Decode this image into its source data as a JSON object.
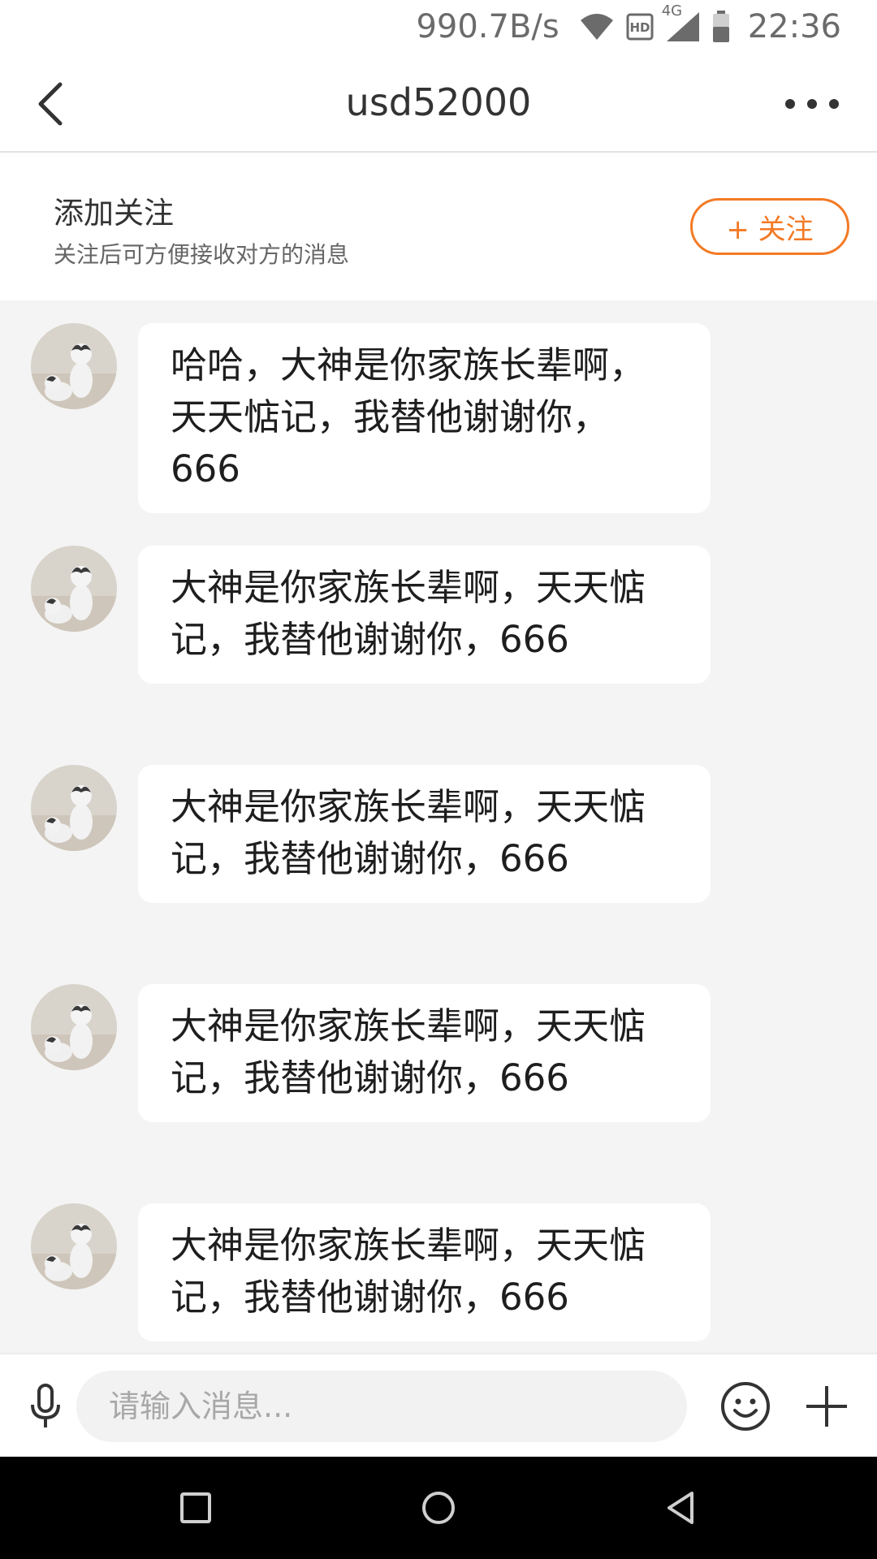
{
  "status_bar": {
    "net_speed": "990.7B/s",
    "network_type": "4G",
    "hd_badge": "HD",
    "time": "22:36",
    "icons": [
      "wifi-icon",
      "hd-icon",
      "signal-icon",
      "battery-icon"
    ]
  },
  "header": {
    "title": "usd52000",
    "back_icon": "chevron-left-icon",
    "more_icon": "more-dots-icon"
  },
  "follow_banner": {
    "title": "添加关注",
    "subtitle": "关注后可方便接收对方的消息",
    "button_label": "+ 关注"
  },
  "messages": [
    {
      "text": "哈哈，大神是你家族长辈啊，天天惦记，我替他谢谢你，666"
    },
    {
      "text": "大神是你家族长辈啊，天天惦记，我替他谢谢你，666"
    },
    {
      "text": "大神是你家族长辈啊，天天惦记，我替他谢谢你，666"
    },
    {
      "text": "大神是你家族长辈啊，天天惦记，我替他谢谢你，666"
    },
    {
      "text": "大神是你家族长辈啊，天天惦记，我替他谢谢你，666"
    }
  ],
  "input_bar": {
    "placeholder": "请输入消息...",
    "icons": [
      "microphone-icon",
      "emoji-icon",
      "plus-icon"
    ]
  },
  "nav_bar": {
    "icons": [
      "recents-icon",
      "home-icon",
      "back-icon"
    ]
  },
  "colors": {
    "accent": "#f37a25",
    "chat_background": "#f4f4f4",
    "bubble": "#ffffff",
    "nav_bar": "#000000"
  }
}
